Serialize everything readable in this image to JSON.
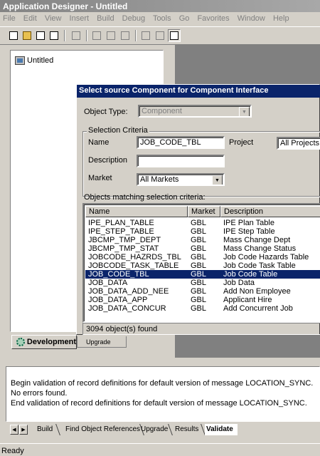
{
  "window": {
    "title": "Application Designer - Untitled"
  },
  "menu": [
    "File",
    "Edit",
    "View",
    "Insert",
    "Build",
    "Debug",
    "Tools",
    "Go",
    "Favorites",
    "Window",
    "Help"
  ],
  "project_tree": {
    "root": "Untitled"
  },
  "project_tabs": {
    "development": "Development",
    "upgrade": "Upgrade"
  },
  "dialog": {
    "title": "Select source Component for Component Interface",
    "object_type_label": "Object Type:",
    "object_type_value": "Component",
    "criteria_title": "Selection Criteria",
    "name_label": "Name",
    "name_value": "JOB_CODE_TBL",
    "project_label": "Project",
    "project_value": "All Projects",
    "description_label": "Description",
    "description_value": "",
    "market_label": "Market",
    "market_value": "All Markets",
    "matching_label": "Objects matching selection criteria:",
    "columns": {
      "name": "Name",
      "market": "Market",
      "description": "Description"
    },
    "rows": [
      {
        "name": "IPE_PLAN_TABLE",
        "market": "GBL",
        "description": "IPE Plan Table"
      },
      {
        "name": "IPE_STEP_TABLE",
        "market": "GBL",
        "description": "IPE Step Table"
      },
      {
        "name": "JBCMP_TMP_DEPT",
        "market": "GBL",
        "description": "Mass Change Dept"
      },
      {
        "name": "JBCMP_TMP_STAT",
        "market": "GBL",
        "description": "Mass Change Status"
      },
      {
        "name": "JOBCODE_HAZRDS_TBL",
        "market": "GBL",
        "description": "Job Code Hazards Table"
      },
      {
        "name": "JOBCODE_TASK_TABLE",
        "market": "GBL",
        "description": "Job Code Task Table"
      },
      {
        "name": "JOB_CODE_TBL",
        "market": "GBL",
        "description": "Job Code Table"
      },
      {
        "name": "JOB_DATA",
        "market": "GBL",
        "description": "Job Data"
      },
      {
        "name": "JOB_DATA_ADD_NEE",
        "market": "GBL",
        "description": "Add Non Employee"
      },
      {
        "name": "JOB_DATA_APP",
        "market": "GBL",
        "description": "Applicant Hire"
      },
      {
        "name": "JOB_DATA_CONCUR",
        "market": "GBL",
        "description": "Add Concurrent Job"
      }
    ],
    "selected_index": 6,
    "found_text": "3094 object(s) found"
  },
  "output": {
    "lines": [
      "Begin validation of record definitions for default version of message LOCATION_SYNC.",
      "No errors found.",
      "End validation of record definitions for default version of message LOCATION_SYNC."
    ]
  },
  "output_tabs": [
    "Build",
    "Find Object References",
    "Upgrade",
    "Results",
    "Validate"
  ],
  "status": {
    "text": "Ready"
  }
}
